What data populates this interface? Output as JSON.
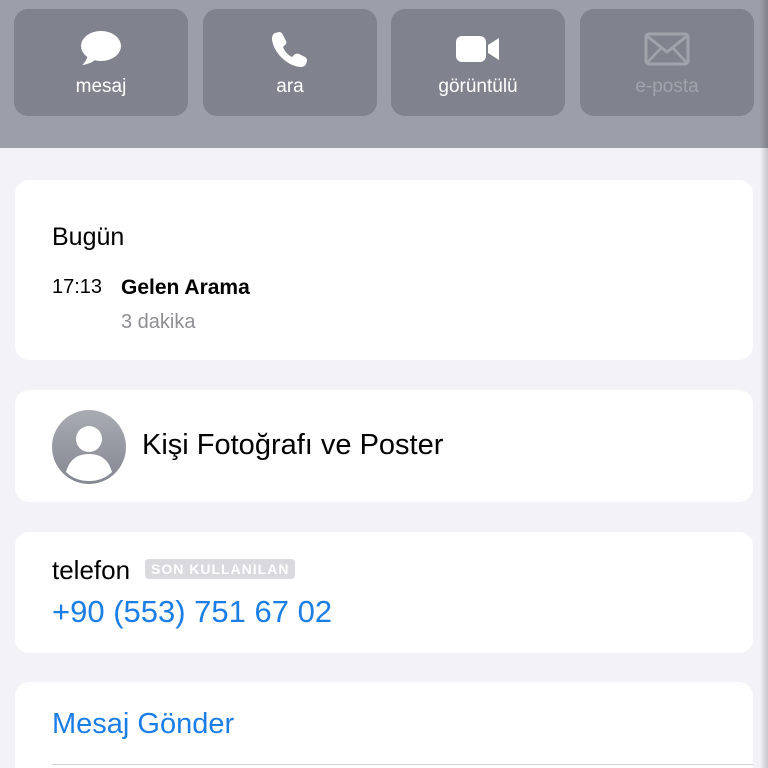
{
  "actions": {
    "message": {
      "label": "mesaj",
      "icon": "message-bubble-icon"
    },
    "call": {
      "label": "ara",
      "icon": "phone-icon"
    },
    "video": {
      "label": "görüntülü",
      "icon": "video-camera-icon"
    },
    "email": {
      "label": "e-posta",
      "icon": "envelope-icon",
      "enabled": false
    }
  },
  "history": {
    "title": "Bugün",
    "time": "17:13",
    "type": "Gelen Arama",
    "duration": "3 dakika"
  },
  "contact_photo": {
    "label": "Kişi Fotoğrafı ve Poster",
    "icon": "person-avatar-icon"
  },
  "phone": {
    "label": "telefon",
    "badge": "SON KULLANILAN",
    "number": "+90 (553) 751 67 02"
  },
  "message_link": {
    "label": "Mesaj Gönder"
  },
  "colors": {
    "header_bg": "#9c9ea9",
    "button_bg": "#80828d",
    "page_bg": "#f2f2f7",
    "link_blue": "#1a7ee6",
    "secondary_text": "#8e8e93"
  }
}
